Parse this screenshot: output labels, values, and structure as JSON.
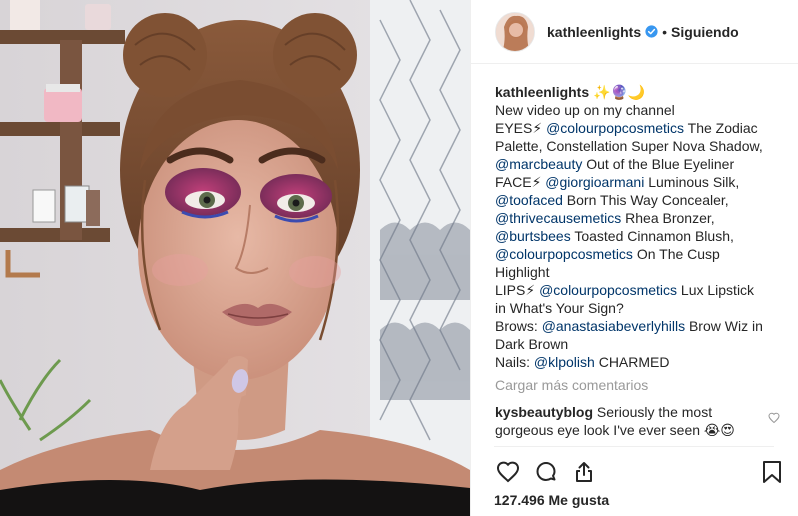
{
  "colors": {
    "link": "#003569",
    "muted": "#999999",
    "text": "#262626",
    "verified": "#3897f0"
  },
  "header": {
    "username": "kathleenlights",
    "separator": "•",
    "follow_status": "Siguiendo",
    "icons": [
      "avatar",
      "verified-badge-icon"
    ]
  },
  "caption": {
    "username": "kathleenlights",
    "emojis": "✨🔮🌙",
    "lines": [
      [
        {
          "t": "New video up on my channel"
        }
      ],
      [
        {
          "t": "EYES⚡ "
        },
        {
          "t": "@colourpopcosmetics",
          "tag": true
        },
        {
          "t": " The Zodiac"
        }
      ],
      [
        {
          "t": "Palette, Constellation Super Nova Shadow,"
        }
      ],
      [
        {
          "t": "@marcbeauty",
          "tag": true
        },
        {
          "t": " Out of the Blue Eyeliner"
        }
      ],
      [
        {
          "t": "FACE⚡ "
        },
        {
          "t": "@giorgioarmani",
          "tag": true
        },
        {
          "t": " Luminous Silk,"
        }
      ],
      [
        {
          "t": "@toofaced",
          "tag": true
        },
        {
          "t": " Born This Way Concealer,"
        }
      ],
      [
        {
          "t": "@thrivecausemetics",
          "tag": true
        },
        {
          "t": " Rhea Bronzer,"
        }
      ],
      [
        {
          "t": "@burtsbees",
          "tag": true
        },
        {
          "t": " Toasted Cinnamon Blush,"
        }
      ],
      [
        {
          "t": "@colourpopcosmetics",
          "tag": true
        },
        {
          "t": " On The Cusp"
        }
      ],
      [
        {
          "t": "Highlight"
        }
      ],
      [
        {
          "t": "LIPS⚡ "
        },
        {
          "t": "@colourpopcosmetics",
          "tag": true
        },
        {
          "t": " Lux Lipstick"
        }
      ],
      [
        {
          "t": "in What's Your Sign?"
        }
      ],
      [
        {
          "t": "Brows: "
        },
        {
          "t": "@anastasiabeverlyhills",
          "tag": true
        },
        {
          "t": " Brow Wiz in"
        }
      ],
      [
        {
          "t": "Dark Brown"
        }
      ],
      [
        {
          "t": "Nails: "
        },
        {
          "t": "@klpolish",
          "tag": true
        },
        {
          "t": " CHARMED"
        }
      ]
    ]
  },
  "load_more": "Cargar más comentarios",
  "comment": {
    "username": "kysbeautyblog",
    "text_line1": "Seriously the most",
    "text_line2": "gorgeous eye look I've ever seen 😭😍"
  },
  "actions": {
    "icons": [
      "heart-icon",
      "comment-icon",
      "share-icon",
      "bookmark-icon"
    ]
  },
  "likes": "127.496 Me gusta"
}
